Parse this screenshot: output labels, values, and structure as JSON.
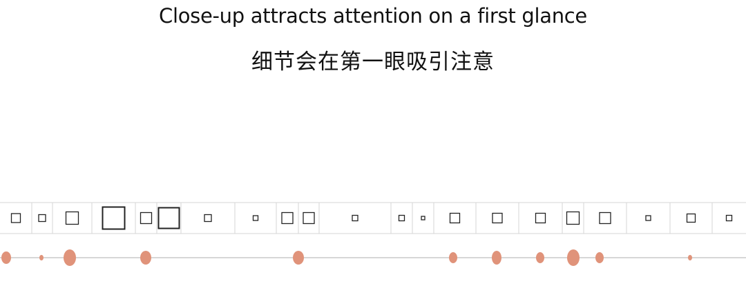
{
  "slide": {
    "title_en": "Close-up attracts attention on a first glance",
    "title_zh": "细节会在第一眼吸引注意"
  },
  "colors": {
    "grid_line": "#d6d6d6",
    "square_stroke": "#222222",
    "dot_fill": "#e0937a",
    "timeline": "#c8c8c8"
  }
}
